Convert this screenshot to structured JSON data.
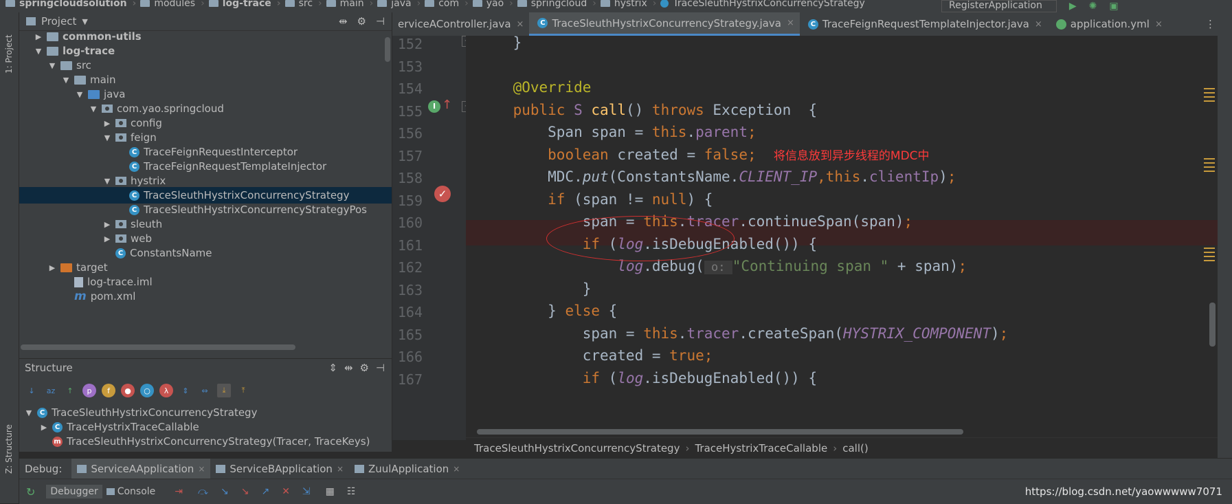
{
  "breadcrumb": [
    "springcloudsolution",
    "modules",
    "log-trace",
    "src",
    "main",
    "java",
    "com",
    "yao",
    "springcloud",
    "hystrix",
    "TraceSleuthHystrixConcurrencyStrategy"
  ],
  "run_config": "RegisterApplication",
  "left_stripe": {
    "project_tab": "1: Project",
    "structure_tab": "Z: Structure"
  },
  "project_panel": {
    "title": "Project",
    "tree": [
      {
        "label": "common-utils",
        "level": 1,
        "kind": "module",
        "arrow": "right",
        "bold": true
      },
      {
        "label": "log-trace",
        "level": 1,
        "kind": "module",
        "arrow": "down",
        "bold": true
      },
      {
        "label": "src",
        "level": 2,
        "kind": "folder",
        "arrow": "down"
      },
      {
        "label": "main",
        "level": 3,
        "kind": "folder",
        "arrow": "down"
      },
      {
        "label": "java",
        "level": 4,
        "kind": "folder-blue",
        "arrow": "down"
      },
      {
        "label": "com.yao.springcloud",
        "level": 5,
        "kind": "package",
        "arrow": "down"
      },
      {
        "label": "config",
        "level": 6,
        "kind": "package",
        "arrow": "right"
      },
      {
        "label": "feign",
        "level": 6,
        "kind": "package",
        "arrow": "down"
      },
      {
        "label": "TraceFeignRequestInterceptor",
        "level": 7,
        "kind": "class"
      },
      {
        "label": "TraceFeignRequestTemplateInjector",
        "level": 7,
        "kind": "class"
      },
      {
        "label": "hystrix",
        "level": 6,
        "kind": "package",
        "arrow": "down"
      },
      {
        "label": "TraceSleuthHystrixConcurrencyStrategy",
        "level": 7,
        "kind": "class",
        "selected": true
      },
      {
        "label": "TraceSleuthHystrixConcurrencyStrategyPos",
        "level": 7,
        "kind": "class"
      },
      {
        "label": "sleuth",
        "level": 6,
        "kind": "package",
        "arrow": "right"
      },
      {
        "label": "web",
        "level": 6,
        "kind": "package",
        "arrow": "right"
      },
      {
        "label": "ConstantsName",
        "level": 6,
        "kind": "class"
      },
      {
        "label": "target",
        "level": 2,
        "kind": "folder-orange",
        "arrow": "right"
      },
      {
        "label": "log-trace.iml",
        "level": 3,
        "kind": "file"
      },
      {
        "label": "pom.xml",
        "level": 3,
        "kind": "maven"
      }
    ]
  },
  "structure_panel": {
    "title": "Structure",
    "items": [
      {
        "label": "TraceSleuthHystrixConcurrencyStrategy",
        "level": 0,
        "arrow": "down",
        "icon": "C"
      },
      {
        "label": "TraceHystrixTraceCallable",
        "level": 1,
        "arrow": "right",
        "icon": "C"
      },
      {
        "label": "TraceSleuthHystrixConcurrencyStrategy(Tracer, TraceKeys)",
        "level": 1,
        "icon": "m"
      }
    ]
  },
  "editor_tabs": [
    {
      "label": "erviceAController.java",
      "active": false
    },
    {
      "label": "TraceSleuthHystrixConcurrencyStrategy.java",
      "active": true
    },
    {
      "label": "TraceFeignRequestTemplateInjector.java",
      "active": false
    },
    {
      "label": "application.yml",
      "active": false
    }
  ],
  "code_lines": [
    {
      "n": "152",
      "html": "    }"
    },
    {
      "n": "153",
      "html": ""
    },
    {
      "n": "154",
      "html": "    <span class='ann'>@Override</span>"
    },
    {
      "n": "155",
      "html": "    <span class='kw'>public</span> <span class='fld'>S</span> <span class='fn'>call</span>() <span class='kw'>throws</span> Exception  {"
    },
    {
      "n": "156",
      "html": "        Span span = <span class='kw'>this</span>.<span class='fld'>parent</span><span class='kw'>;</span>"
    },
    {
      "n": "157",
      "html": "        <span class='kw'>boolean</span> created = <span class='kw'>false;</span>  <span class='cmt'>将信息放到异步线程的MDC中</span>"
    },
    {
      "n": "158",
      "html": "        MDC.<span class='it'>put</span>(ConstantsName.<span class='fld it'>CLIENT_IP</span><span class='kw'>,</span><span class='kw'>this</span>.<span class='fld'>clientIp</span>)<span class='kw'>;</span>"
    },
    {
      "n": "159",
      "html": "        <span class='kw'>if</span> (span != <span class='kw'>null</span>) {"
    },
    {
      "n": "160",
      "html": "            span = <span class='kw'>this</span>.<span class='fld'>tracer</span>.continueSpan(span)<span class='kw'>;</span>"
    },
    {
      "n": "161",
      "html": "            <span class='kw'>if</span> (<span class='fld it'>log</span>.isDebugEnabled()) {"
    },
    {
      "n": "162",
      "html": "                <span class='fld it'>log</span>.debug(<span class='hint'> o: </span><span class='str'>\"Continuing span \"</span> + span)<span class='kw'>;</span>"
    },
    {
      "n": "163",
      "html": "            }"
    },
    {
      "n": "164",
      "html": "        } <span class='kw'>else</span> {"
    },
    {
      "n": "165",
      "html": "            span = <span class='kw'>this</span>.<span class='fld'>tracer</span>.createSpan(<span class='fld it'>HYSTRIX_COMPONENT</span>)<span class='kw'>;</span>"
    },
    {
      "n": "166",
      "html": "            created = <span class='kw'>true;</span>"
    },
    {
      "n": "167",
      "html": "            <span class='kw'>if</span> (<span class='fld it'>log</span>.isDebugEnabled()) {"
    }
  ],
  "editor_breadcrumb": [
    "TraceSleuthHystrixConcurrencyStrategy",
    "TraceHystrixTraceCallable",
    "call()"
  ],
  "debug": {
    "label": "Debug:",
    "sessions": [
      "ServiceAApplication",
      "ServiceBApplication",
      "ZuulApplication"
    ],
    "tabs": [
      "Debugger",
      "Console"
    ],
    "watermark": "https://blog.csdn.net/yaowwwww7071"
  },
  "colors": {
    "accent": "#4a88c7",
    "keyword": "#cc7832",
    "annotation": "#bbb529",
    "comment_red": "#ff3b3b"
  }
}
